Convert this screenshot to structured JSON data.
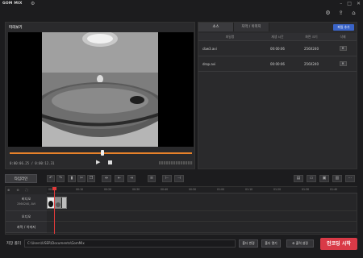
{
  "app": {
    "title": "GOM MIX"
  },
  "preview": {
    "title": "미리보기",
    "timecode": "0:00:06.25 / 0:00:12.31",
    "progress_percent": 51
  },
  "source_panel": {
    "tabs": [
      {
        "label": "소스",
        "active": true
      },
      {
        "label": "자막 / 이미지",
        "active": false
      }
    ],
    "add_file_label": "파일 추가",
    "columns": [
      "파일명",
      "재생 시간",
      "화면 크기",
      "삭제"
    ],
    "files": [
      {
        "name": "cbw3.avi",
        "duration": "00:00:06",
        "size": "256X240",
        "delete": "✕"
      },
      {
        "name": "drop.avi",
        "duration": "00:00:06",
        "size": "256X240",
        "delete": "✕"
      }
    ]
  },
  "edit": {
    "mode_label": "타임라인"
  },
  "timeline": {
    "ruler": [
      "00:00",
      "00:10",
      "00:20",
      "00:30",
      "00:40",
      "00:50",
      "01:00",
      "01:10",
      "01:20",
      "01:30",
      "01:40"
    ],
    "tracks": [
      {
        "label": "비디오",
        "sub": "256X240, AVI"
      },
      {
        "label": "오디오"
      },
      {
        "label": "자막 / 이미지"
      }
    ]
  },
  "bottom": {
    "save_label": "저장 폴더",
    "save_path": "C:\\Users\\USER\\Documents\\GomMix",
    "change_folder_label": "폴더 변경",
    "open_folder_label": "폴더 열기",
    "output_settings_label": "출력 설정",
    "encode_label": "인코딩 시작"
  },
  "colors": {
    "accent": "#e8822a",
    "encode": "#d93a47",
    "add_file": "#3a64c8",
    "playhead": "#e23a3a"
  }
}
